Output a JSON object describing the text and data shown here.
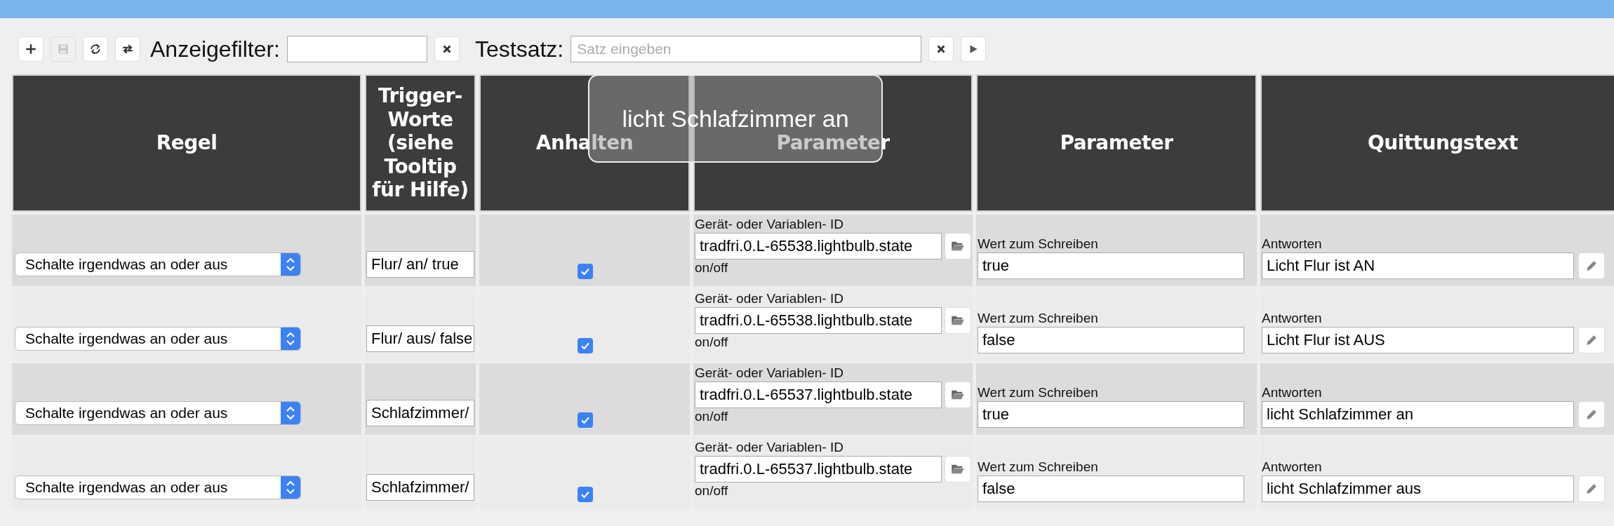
{
  "toolbar": {
    "buttons": [
      {
        "kind": "add",
        "disabled": false
      },
      {
        "kind": "save",
        "disabled": true
      },
      {
        "kind": "sync",
        "disabled": false
      },
      {
        "kind": "swap",
        "disabled": false
      }
    ],
    "filter": {
      "label": "Anzeigefilter:"
    },
    "test": {
      "label": "Testsatz:",
      "placeholder": "Satz eingeben"
    }
  },
  "table": {
    "columns": [
      "Regel",
      "Trigger-Worte (siehe Tooltip für Hilfe)",
      "Anhalten",
      "Parameter",
      "Parameter",
      "Quittungstext"
    ],
    "rows": [
      {
        "rule": "Schalte irgendwas an oder aus",
        "trigger": "Flur/ an/ true",
        "stop": true,
        "id_label": "Gerät- oder Variablen- ID",
        "id_value": "tradfri.0.L-65538.lightbulb.state",
        "id_hint": "on/off",
        "value_label": "Wert zum Schreiben",
        "value": "true",
        "reply_label": "Antworten",
        "reply": "Licht Flur ist AN"
      },
      {
        "rule": "Schalte irgendwas an oder aus",
        "trigger": "Flur/ aus/ false",
        "stop": true,
        "id_label": "Gerät- oder Variablen- ID",
        "id_value": "tradfri.0.L-65538.lightbulb.state",
        "id_hint": "on/off",
        "value_label": "Wert zum Schreiben",
        "value": "false",
        "reply_label": "Antworten",
        "reply": "Licht Flur ist AUS"
      },
      {
        "rule": "Schalte irgendwas an oder aus",
        "trigger": "Schlafzimmer/",
        "stop": true,
        "id_label": "Gerät- oder Variablen- ID",
        "id_value": "tradfri.0.L-65537.lightbulb.state",
        "id_hint": "on/off",
        "value_label": "Wert zum Schreiben",
        "value": "true",
        "reply_label": "Antworten",
        "reply": "licht Schlafzimmer an"
      },
      {
        "rule": "Schalte irgendwas an oder aus",
        "trigger": "Schlafzimmer/",
        "stop": true,
        "id_label": "Gerät- oder Variablen- ID",
        "id_value": "tradfri.0.L-65537.lightbulb.state",
        "id_hint": "on/off",
        "value_label": "Wert zum Schreiben",
        "value": "false",
        "reply_label": "Antworten",
        "reply": "licht Schlafzimmer aus"
      }
    ]
  },
  "tooltip": {
    "text": "licht Schlafzimmer an"
  }
}
